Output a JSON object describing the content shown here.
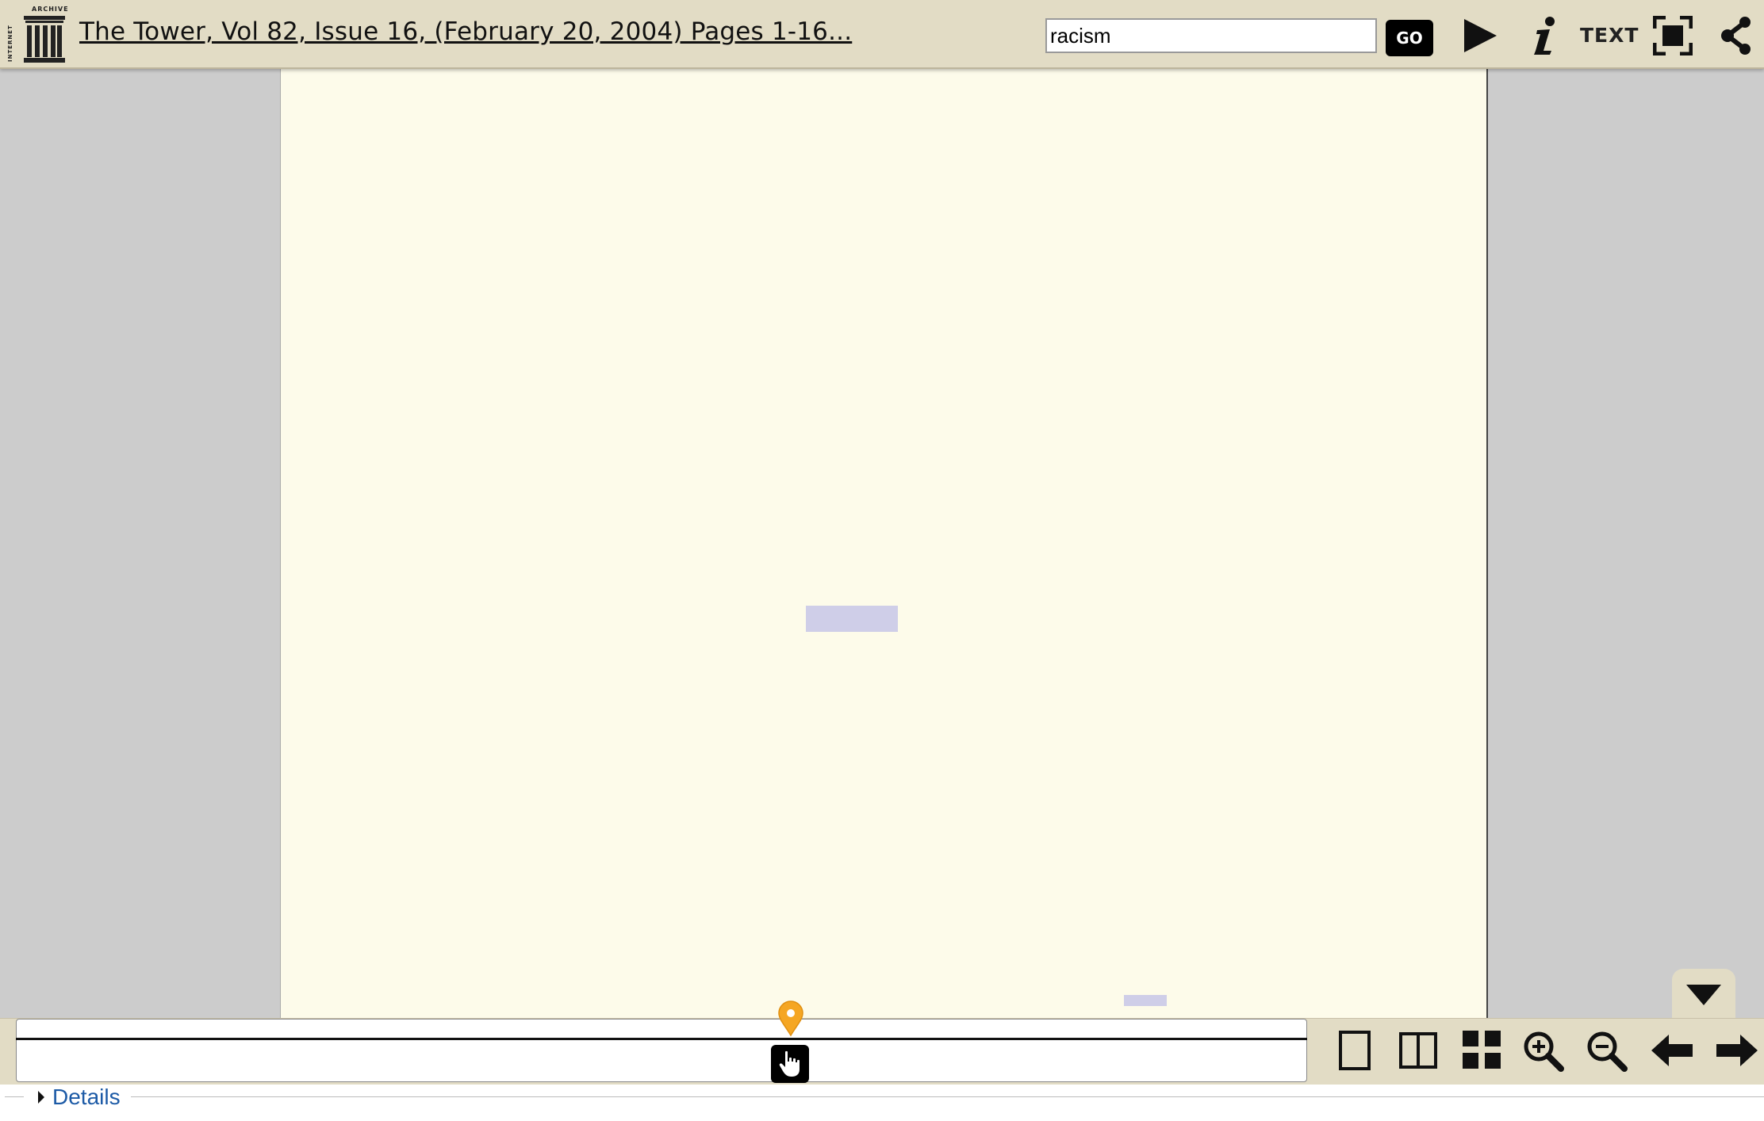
{
  "header": {
    "logo_icon": "internet-archive-logo",
    "logo_text": "INTERNET ARCHIVE",
    "title": "The Tower, Vol 82, Issue 16, (February 20, 2004) Pages 1-16...",
    "search": {
      "value": "racism",
      "placeholder": ""
    },
    "go_label": "GO",
    "icons": [
      "play-icon",
      "info-icon",
      "fullscreen-icon",
      "share-icon"
    ],
    "text_label": "TEXT"
  },
  "viewer": {
    "page_color": "#fdfbea",
    "highlight_color": "#aaaae6"
  },
  "navbar": {
    "position_fraction": 0.59,
    "icons": [
      "one-page-icon",
      "two-page-icon",
      "thumbnail-icon",
      "zoom-in-icon",
      "zoom-out-icon",
      "prev-page-icon",
      "next-page-icon"
    ],
    "collapse_icon": "chevron-down-icon",
    "marker_color": "#f5a623"
  },
  "details": {
    "label": "Details"
  }
}
